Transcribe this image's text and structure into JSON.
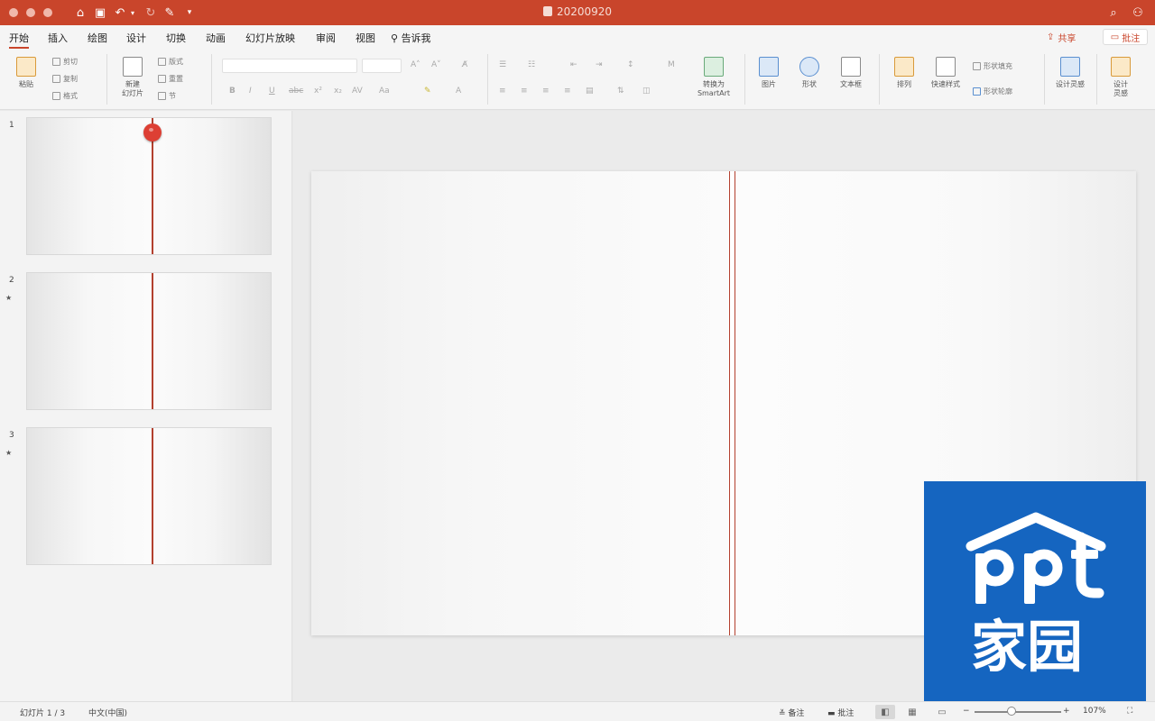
{
  "titlebar": {
    "document_title": "20200920",
    "quick_access": {
      "home": "⌂",
      "save": "▣",
      "undo": "↶",
      "redo": "↻",
      "customize": "▾"
    },
    "accent_color": "#c9452b"
  },
  "tabs": [
    {
      "label": "开始",
      "active": true
    },
    {
      "label": "插入"
    },
    {
      "label": "绘图"
    },
    {
      "label": "设计"
    },
    {
      "label": "切换"
    },
    {
      "label": "动画"
    },
    {
      "label": "幻灯片放映"
    },
    {
      "label": "审阅"
    },
    {
      "label": "视图"
    }
  ],
  "tell_me": "告诉我",
  "share_label": "共享",
  "comment_label": "批注",
  "toolbar": {
    "paste": "粘贴",
    "cut": "剪切",
    "copy": "复制",
    "format": "格式",
    "new_slide": "新建\n幻灯片",
    "layout": "版式",
    "reset": "重置",
    "section": "节",
    "convert_smartart": "转换为\nSmartArt",
    "picture": "图片",
    "shapes": "形状",
    "textbox": "文本框",
    "arrange": "排列",
    "quick_styles": "快速样式",
    "shape_fill": "形状填充",
    "shape_outline": "形状轮廓",
    "designer": "设计灵感",
    "design_ideas": "设计\n灵感"
  },
  "slides": [
    {
      "number": "1",
      "has_pin": true,
      "star": false
    },
    {
      "number": "2",
      "has_pin": false,
      "star": true
    },
    {
      "number": "3",
      "has_pin": false,
      "star": true
    }
  ],
  "watermark": {
    "logo_text": "ppt家园",
    "color": "#1565c0"
  },
  "statusbar": {
    "slide_info": "幻灯片 1 / 3",
    "language": "中文(中国)",
    "notes": "备注",
    "comments": "批注",
    "zoom": "107%",
    "zoom_fraction": 0.43
  }
}
